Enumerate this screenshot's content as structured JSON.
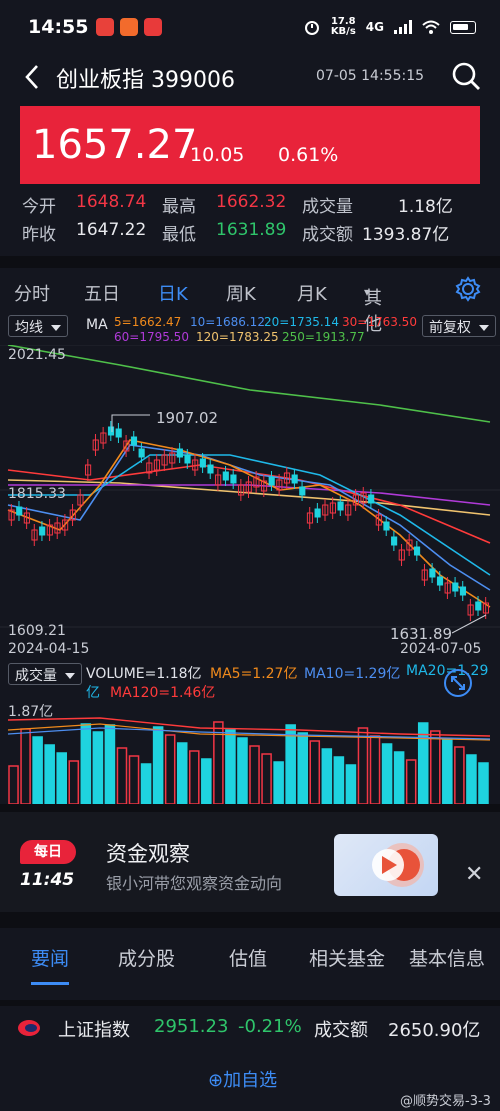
{
  "status_bar": {
    "time": "14:55",
    "net_speed": "17.8",
    "net_unit": "KB/s",
    "signal": "4G"
  },
  "nav": {
    "title": "创业板指 399006",
    "datetime": "07-05 14:55:15"
  },
  "quote": {
    "price": "1657.27",
    "change": "10.05",
    "change_pct": "0.61%",
    "open_label": "今开",
    "open": "1648.74",
    "high_label": "最高",
    "high": "1662.32",
    "volume_label": "成交量",
    "volume": "1.18亿",
    "prev_close_label": "昨收",
    "prev_close": "1647.22",
    "low_label": "最低",
    "low": "1631.89",
    "amount_label": "成交额",
    "amount": "1393.87亿"
  },
  "period_tabs": [
    "分时",
    "五日",
    "日K",
    "周K",
    "月K",
    "其他"
  ],
  "period_active": "日K",
  "other_caret": "▾",
  "chart_controls": {
    "indicator_select": "均线",
    "ma_label": "MA",
    "ma5": "5=1662.47",
    "ma10": "10=1686.12",
    "ma20": "20=1735.14",
    "ma30": "30=1763.50",
    "ma60": "60=1795.50",
    "ma120": "120=1783.25",
    "ma250": "250=1913.77",
    "adjust_select": "前复权"
  },
  "price_chart_labels": {
    "top": "2021.45",
    "mid": "1815.33",
    "bottom": "1609.21",
    "peak": "1907.02",
    "trough": "1631.89",
    "date_start": "2024-04-15",
    "date_end": "2024-07-05"
  },
  "volume_controls": {
    "select": "成交量",
    "volume": "VOLUME=1.18亿",
    "ma5": "MA5=1.27亿",
    "ma10": "MA10=1.29亿",
    "ma20_a": "MA20=1.29",
    "ma20_b": "亿",
    "ma120": "MA120=1.46亿",
    "axis_max": "1.87亿"
  },
  "colors": {
    "up": "#f23645",
    "down": "#1fd3df",
    "ma5": "#f08a1c",
    "ma10": "#4d8ef0",
    "ma20": "#1fb8e8",
    "ma30": "#ff3b3b",
    "ma60": "#b03ad8",
    "ma120": "#f0c36e",
    "ma250": "#4fc04a",
    "accent": "#3d8cf5"
  },
  "promo": {
    "badge_top": "每日",
    "badge_time": "11:45",
    "title": "资金观察",
    "subtitle": "银小河带您观察资金动向",
    "close": "✕"
  },
  "news_tabs": [
    "要闻",
    "成分股",
    "估值",
    "相关基金",
    "基本信息"
  ],
  "news_active": "要闻",
  "related_index": {
    "name": "上证指数",
    "price": "2951.23",
    "change_pct": "-0.21%",
    "amount_label": "成交额",
    "amount": "2650.90亿"
  },
  "add_favorite": "⊕加自选",
  "watermark": "@顺势交易-3-3"
}
